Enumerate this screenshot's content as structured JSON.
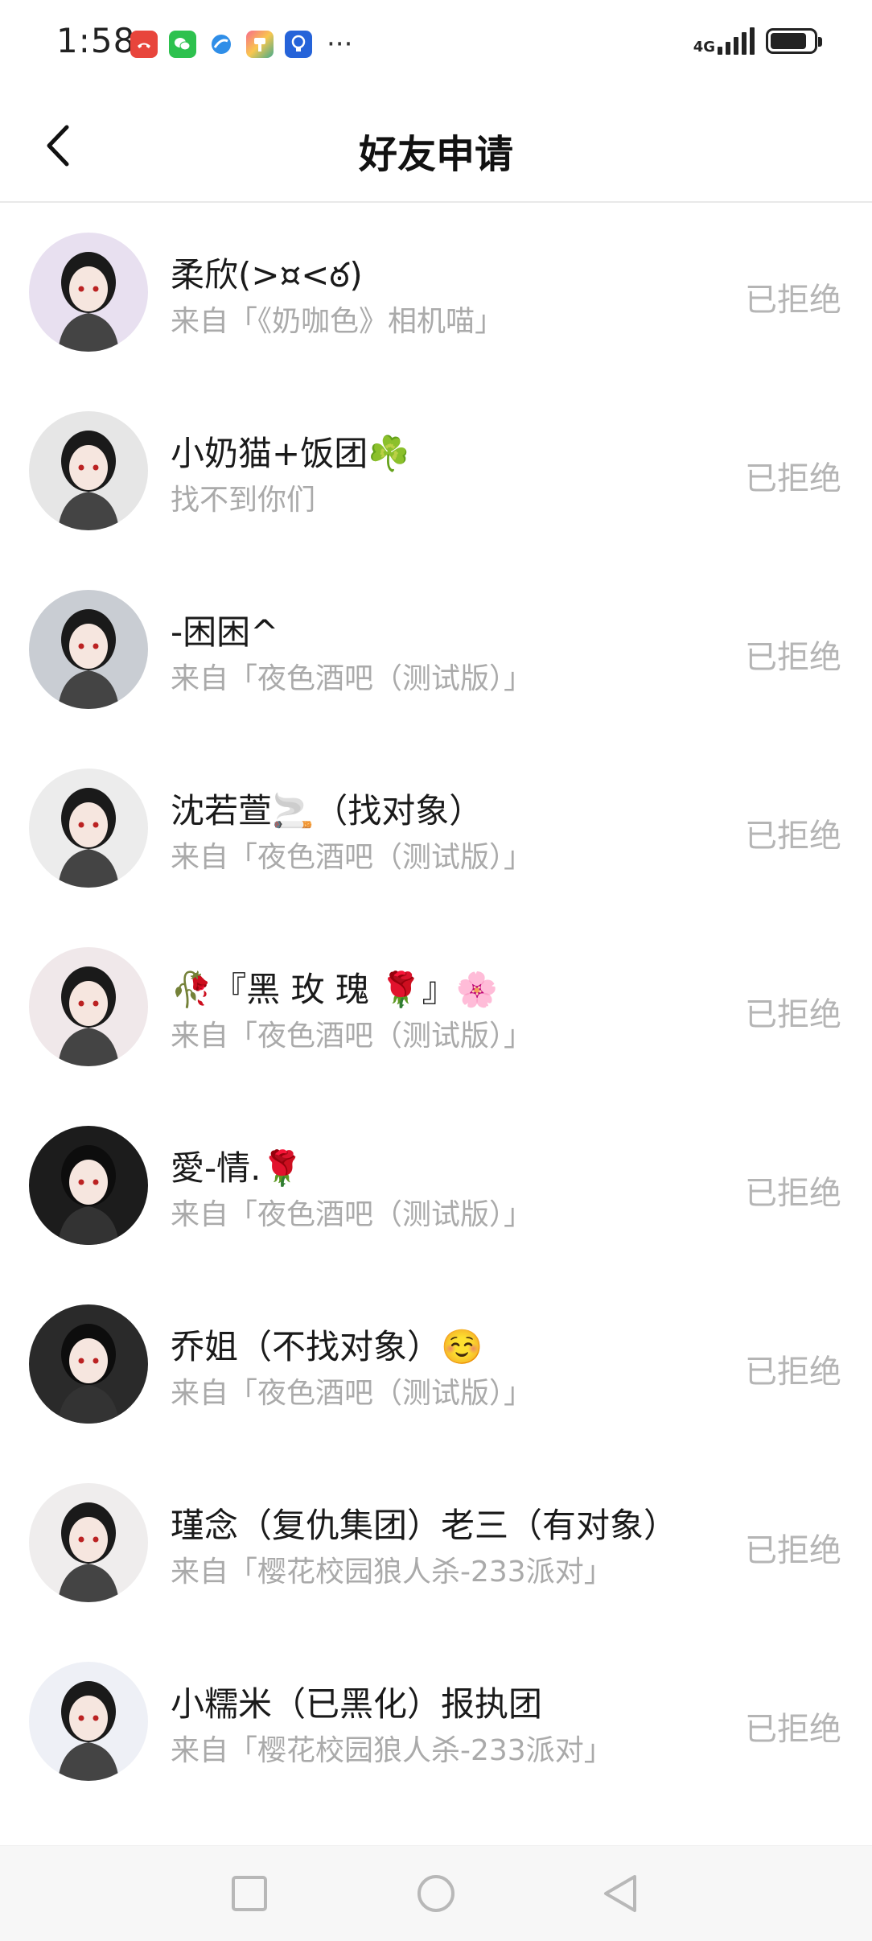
{
  "status_bar": {
    "time": "1:58",
    "network": "4G",
    "more_indicator": "···",
    "app_icons": [
      "phone-missed-icon",
      "wechat-icon",
      "browser-icon",
      "paint-app-icon",
      "bulb-app-icon"
    ],
    "battery_level": 0.85
  },
  "header": {
    "title": "好友申请",
    "back_icon": "chevron-left-icon"
  },
  "requests": [
    {
      "name": "柔欣(>¤<ఠ)",
      "source": "来自「《奶咖色》相机喵」",
      "status": "已拒绝",
      "avatar_bg": "#e8e0f0"
    },
    {
      "name": "小奶猫+饭团☘️",
      "source": "找不到你们",
      "status": "已拒绝",
      "avatar_bg": "#e6e6e6"
    },
    {
      "name": "-困困^",
      "source": "来自「夜色酒吧（测试版）」",
      "status": "已拒绝",
      "avatar_bg": "#c9cdd3"
    },
    {
      "name": "沈若萱🚬（找对象）",
      "source": "来自「夜色酒吧（测试版）」",
      "status": "已拒绝",
      "avatar_bg": "#ececec"
    },
    {
      "name": "🥀『黑 玫 瑰 🌹』🌸",
      "source": "来自「夜色酒吧（测试版）」",
      "status": "已拒绝",
      "avatar_bg": "#f0e8ea"
    },
    {
      "name": "愛-情.🌹",
      "source": "来自「夜色酒吧（测试版）」",
      "status": "已拒绝",
      "avatar_bg": "#1c1c1c"
    },
    {
      "name": "乔姐（不找对象）☺️",
      "source": "来自「夜色酒吧（测试版）」",
      "status": "已拒绝",
      "avatar_bg": "#2a2a2a"
    },
    {
      "name": "瑾念（复仇集团）老三（有对象）",
      "source": "来自「樱花校园狼人杀-233派对」",
      "status": "已拒绝",
      "avatar_bg": "#efeded"
    },
    {
      "name": "小糯米（已黑化）报执团",
      "source": "来自「樱花校园狼人杀-233派对」",
      "status": "已拒绝",
      "avatar_bg": "#eef0f6"
    }
  ],
  "bottom_nav": {
    "recent_icon": "square-recent-icon",
    "home_icon": "circle-home-icon",
    "back_icon": "triangle-back-icon"
  }
}
